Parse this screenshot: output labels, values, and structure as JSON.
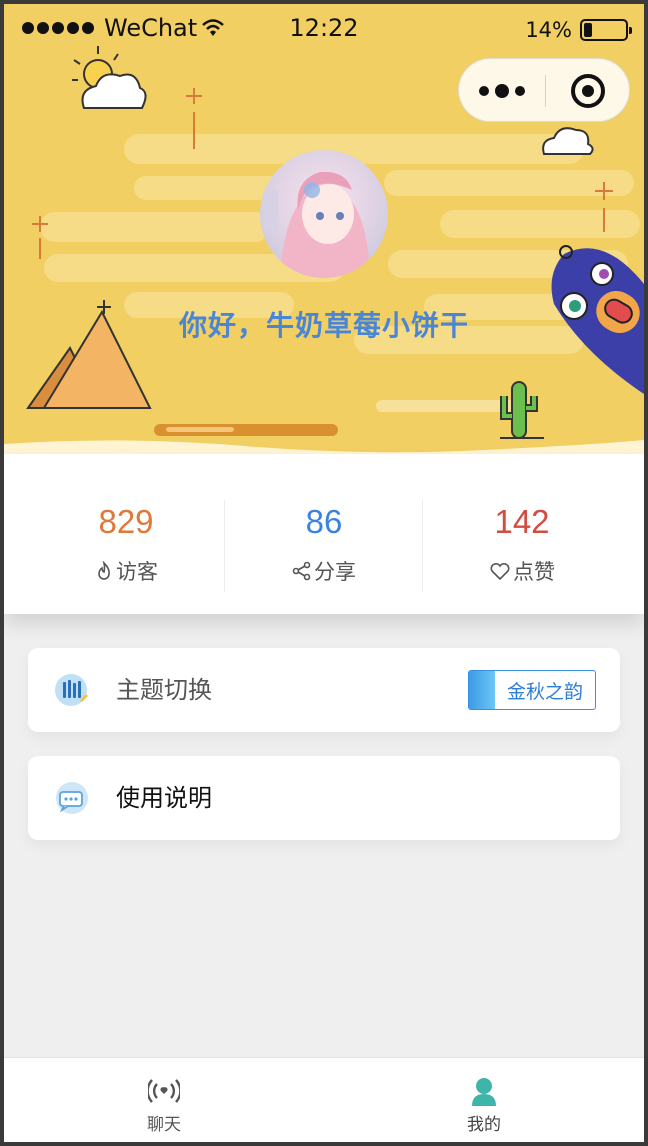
{
  "status_bar": {
    "carrier": "WeChat",
    "time": "12:22",
    "battery": "14%",
    "battery_level": 0.14
  },
  "profile": {
    "greeting": "你好，牛奶草莓小饼干"
  },
  "stats": [
    {
      "value": "829",
      "label": "访客",
      "icon": "flame-icon",
      "color": "#e0783a"
    },
    {
      "value": "86",
      "label": "分享",
      "icon": "share-icon",
      "color": "#3b82e0"
    },
    {
      "value": "142",
      "label": "点赞",
      "icon": "heart-icon",
      "color": "#d24c40"
    }
  ],
  "menu": {
    "theme": {
      "label": "主题切换",
      "value": "金秋之韵",
      "icon": "theme-icon"
    },
    "help": {
      "label": "使用说明",
      "icon": "help-icon"
    }
  },
  "tabbar": {
    "items": [
      {
        "label": "聊天",
        "icon": "broadcast-icon",
        "active": false
      },
      {
        "label": "我的",
        "icon": "person-icon",
        "active": true
      }
    ]
  },
  "colors": {
    "hero_bg": "#f2cf63",
    "accent_blue": "#3b82e0",
    "greeting": "#4a86d6"
  }
}
